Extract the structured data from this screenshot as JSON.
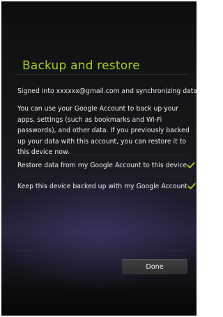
{
  "screen": {
    "title": "Backup and restore",
    "signed_in_text": "Signed into xxxxxx@gmail.com and synchronizing data.",
    "description": "You can use your Google Account to back up your apps, settings (such as bookmarks and Wi-Fi passwords), and other data. If you previously backed up your data with this account, you can restore it to this device now."
  },
  "options": [
    {
      "label": "Restore data from my Google Account to this device",
      "checked": true
    },
    {
      "label": "Keep this device backed up with my Google Account",
      "checked": true
    }
  ],
  "actions": {
    "done_label": "Done"
  },
  "colors": {
    "accent": "#a2cc1e",
    "text": "#ececec",
    "checkmark": "#9ccc1e"
  },
  "icons": {
    "check": "checkmark-icon"
  }
}
